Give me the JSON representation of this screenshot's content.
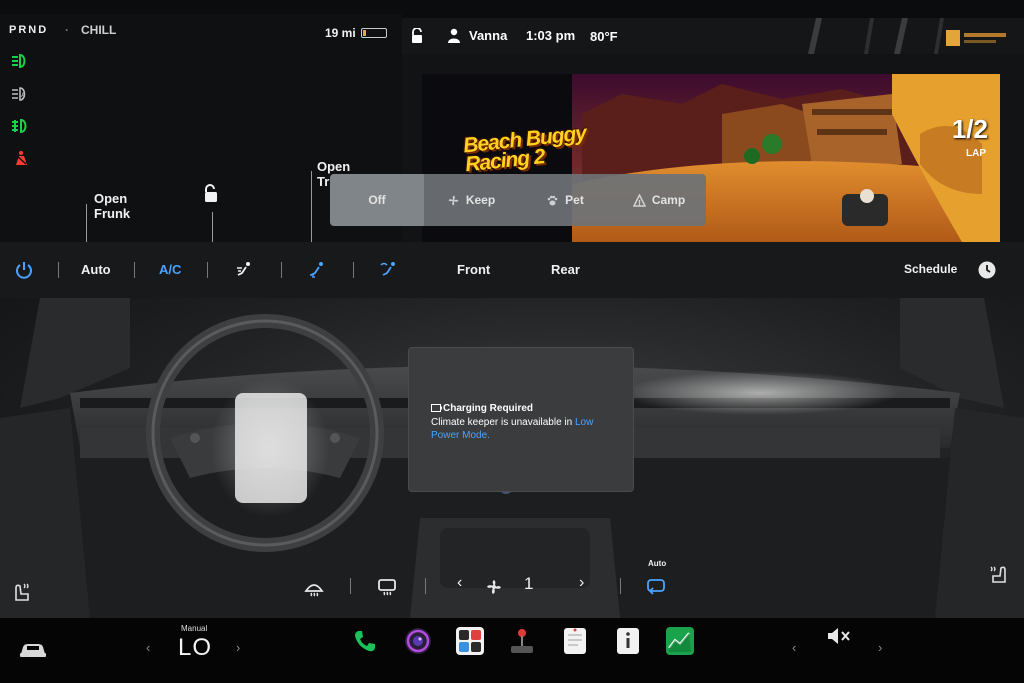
{
  "status": {
    "gear": "PRND",
    "drive_mode": "CHILL",
    "range": "19 mi",
    "battery_level": 0.15
  },
  "car_panel": {
    "frunk_label": "Open\nFrunk",
    "trunk_label": "Open\nTr"
  },
  "header": {
    "user": "Vanna",
    "time": "1:03 pm",
    "temperature": "80°F"
  },
  "media": {
    "game_title": "Beach Buggy\nRacing 2",
    "lap_value": "1/2",
    "lap_label": "LAP"
  },
  "keep_popup": {
    "options": [
      {
        "label": "Off",
        "icon": "none",
        "selected": true
      },
      {
        "label": "Keep",
        "icon": "fan-icon",
        "selected": false
      },
      {
        "label": "Pet",
        "icon": "paw-icon",
        "selected": false
      },
      {
        "label": "Camp",
        "icon": "tent-icon",
        "selected": false
      }
    ]
  },
  "climate_bar": {
    "auto_label": "Auto",
    "ac_label": "A/C",
    "front_label": "Front",
    "rear_label": "Rear",
    "schedule_label": "Schedule"
  },
  "message": {
    "title": "Charging Required",
    "body": "Climate keeper is unavailable in ",
    "link": "Low Power Mode."
  },
  "bottom_climate": {
    "fan_speed": "1",
    "auto_label": "Auto"
  },
  "dock": {
    "temp_mode": "Manual",
    "temp_value": "LO",
    "apps": [
      "phone-app",
      "camera-app",
      "toybox-app",
      "joystick-app",
      "notes-app",
      "manual-app",
      "stocks-app"
    ]
  },
  "colors": {
    "accent_blue": "#4aa3ff",
    "telltale_green": "#19d24a",
    "telltale_red": "#ff3b30",
    "battery": "#e5a43b"
  }
}
